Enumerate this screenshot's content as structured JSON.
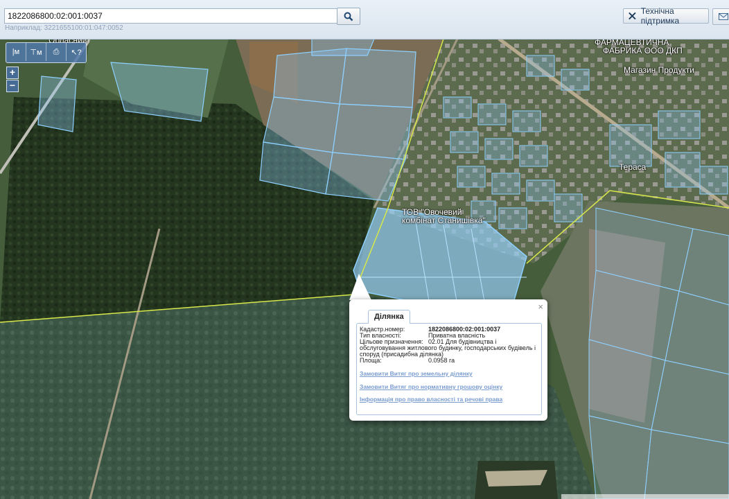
{
  "search": {
    "value": "1822086800:02:001:0037",
    "hint": "Наприклад: 3221655100:01:047:0052"
  },
  "header": {
    "support_label": "Технічна підтримка",
    "support_icon": "wrench-screwdriver-icon",
    "mail_icon": "envelope-icon"
  },
  "toolbar": {
    "icons": [
      "ruler-line-icon",
      "ruler-area-icon",
      "print-icon",
      "info-cursor-icon"
    ]
  },
  "zoom": {
    "in": "+",
    "out": "−"
  },
  "map_labels": {
    "oblasnyi": "Обласний",
    "farm_top": "ФАРМАЦЕВТИЧНА",
    "farm_bottom": "ФАБРИКА ООО ДКП",
    "shop": "Магазин Продукти",
    "terrace": "Тераса",
    "company1": "ТОВ \"Овочевий",
    "company2": "комбінат Станишівка\""
  },
  "popup": {
    "tab": "Ділянка",
    "close": "×",
    "rows": [
      {
        "label": "Кадастр.номер:",
        "value": "1822086800:02:001:0037"
      },
      {
        "label": "Тип власності:",
        "value": "Приватна власність"
      },
      {
        "label": "Цільове призначення:",
        "value": "02.01 Для будівництва і"
      },
      {
        "label": "",
        "value": "обслуговування житлового будинку, господарських будівель і"
      },
      {
        "label": "",
        "value": "споруд (присадибна ділянка)"
      },
      {
        "label": "Площа:",
        "value": "0.0958 га"
      }
    ],
    "links": [
      "Замовити Витяг про земельну ділянку",
      "Замовити Витяг про нормативну грошову оцінку",
      "Інформація про право власності та речові права"
    ]
  },
  "colors": {
    "parcel": "#7ec6f5",
    "boundary": "#d8e84a",
    "link": "#7a9ccf"
  }
}
